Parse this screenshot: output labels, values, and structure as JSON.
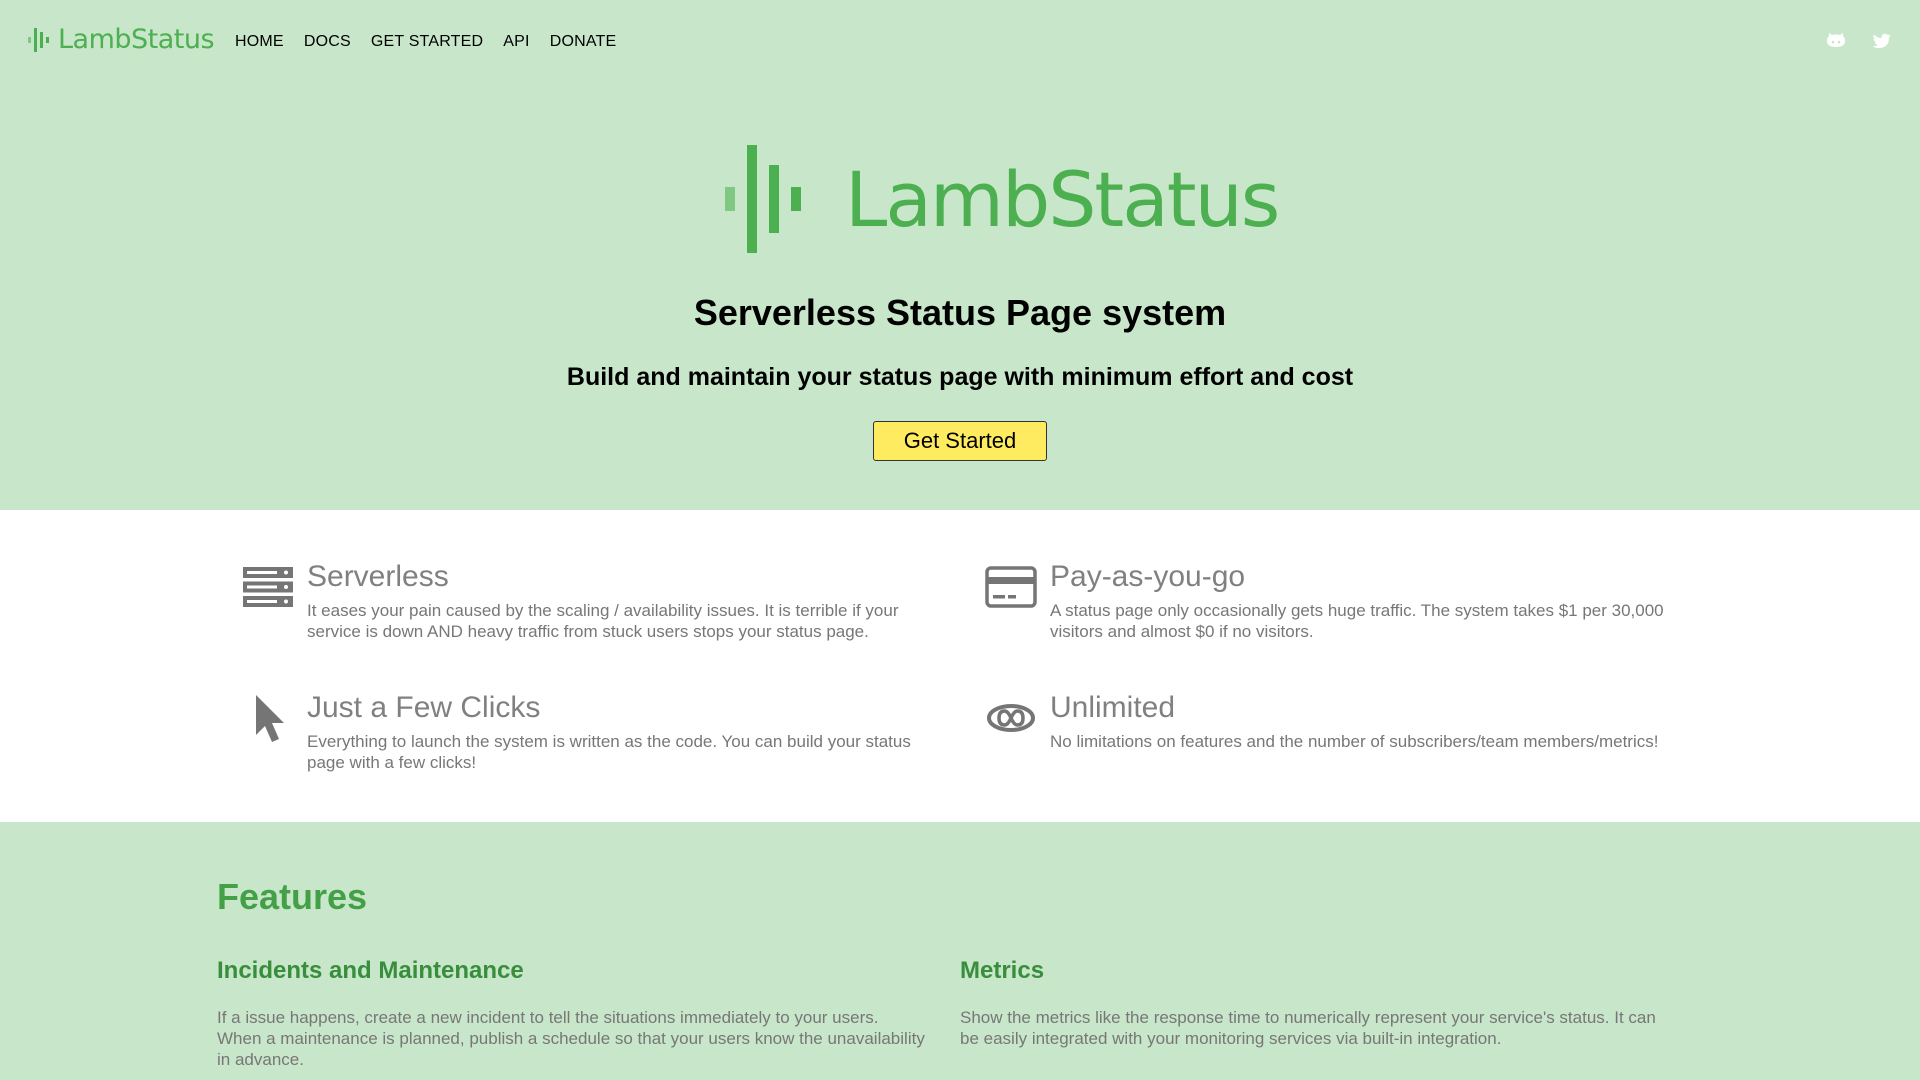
{
  "nav": {
    "logo_text": "LambStatus",
    "links": [
      "HOME",
      "DOCS",
      "GET STARTED",
      "API",
      "DONATE"
    ],
    "social": [
      "github-icon",
      "twitter-icon"
    ]
  },
  "hero": {
    "logo_text": "LambStatus",
    "title": "Serverless Status Page system",
    "subtitle": "Build and maintain your status page with minimum effort and cost",
    "cta_label": "Get Started"
  },
  "benefits": [
    {
      "icon": "server-icon",
      "title": "Serverless",
      "description": "It eases your pain caused by the scaling / availability issues. It is terrible if your service is down AND heavy traffic from stuck users stops your status page."
    },
    {
      "icon": "credit-card-icon",
      "title": "Pay-as-you-go",
      "description": "A status page only occasionally gets huge traffic. The system takes $1 per 30,000 visitors and almost $0 if no visitors."
    },
    {
      "icon": "cursor-icon",
      "title": "Just a Few Clicks",
      "description": "Everything to launch the system is written as the code. You can build your status page with a few clicks!"
    },
    {
      "icon": "infinity-icon",
      "title": "Unlimited",
      "description": "No limitations on features and the number of subscribers/team members/metrics!"
    }
  ],
  "features": {
    "heading": "Features",
    "items": [
      {
        "title": "Incidents and Maintenance",
        "description": "If a issue happens, create a new incident to tell the situations immediately to your users. When a maintenance is planned, publish a schedule so that your users know the unavailability in advance."
      },
      {
        "title": "Metrics",
        "description": "Show the metrics like the response time to numerically represent your service's status. It can be easily integrated with your monitoring services via built-in integration."
      }
    ]
  },
  "colors": {
    "brand_green": "#4caf50",
    "hero_bg": "#c8e6c9",
    "cta_yellow": "#ffeb60"
  }
}
